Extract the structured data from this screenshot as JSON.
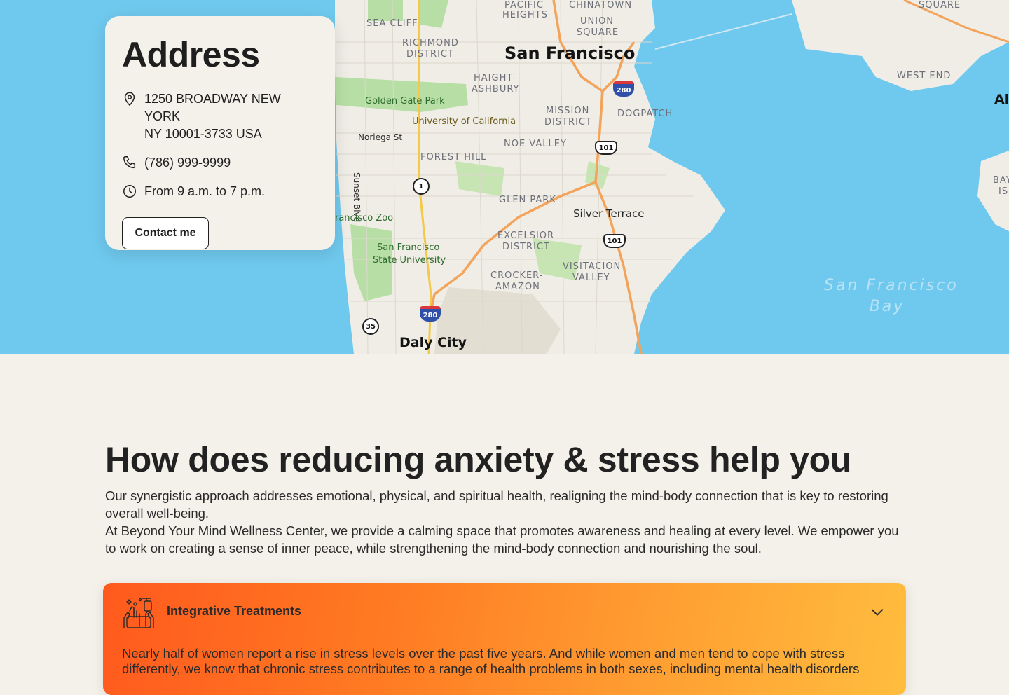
{
  "map": {
    "city_labels": {
      "san_francisco": "San Francisco",
      "daly_city": "Daly City"
    },
    "neighborhoods": {
      "pacific_heights_1": "PACIFIC",
      "pacific_heights_2": "HEIGHTS",
      "chinatown": "CHINATOWN",
      "union_square_1": "UNION",
      "union_square_2": "SQUARE",
      "sea_cliff": "SEA CLIFF",
      "richmond_1": "RICHMOND",
      "richmond_2": "DISTRICT",
      "haight_1": "HAIGHT-",
      "haight_2": "ASHBURY",
      "mission_1": "MISSION",
      "mission_2": "DISTRICT",
      "dogpatch": "DOGPATCH",
      "noe_valley": "NOE VALLEY",
      "forest_hill": "FOREST HILL",
      "glen_park": "GLEN PARK",
      "excelsior_1": "EXCELSIOR",
      "excelsior_2": "DISTRICT",
      "crocker_1": "CROCKER-",
      "crocker_2": "AMAZON",
      "visitacion_1": "VISITACION",
      "visitacion_2": "VALLEY",
      "west_end": "WEST END",
      "square_top": "SQUARE"
    },
    "pois": {
      "golden_gate_park": "Golden Gate Park",
      "uc": "University of California",
      "sf_zoo": "rancisco Zoo",
      "sfsu_1": "San Francisco",
      "sfsu_2": "State University"
    },
    "streets": {
      "noriega": "Noriega St",
      "sunset": "Sunset Blvd"
    },
    "places": {
      "silver_terrace": "Silver Terrace",
      "alameda_partial": "Al",
      "bay_partial_1": "BAY",
      "bay_partial_2": "IS"
    },
    "water": {
      "bay_1": "San Francisco",
      "bay_2": "Bay"
    },
    "shields": {
      "i280_north": "280",
      "i280_south": "280",
      "us101_north": "101",
      "us101_south": "101",
      "ca1": "1",
      "ca35": "35"
    }
  },
  "address_card": {
    "title": "Address",
    "address_line1": "1250  BROADWAY NEW YORK",
    "address_line2": "NY  10001-3733 USA",
    "phone": "(786) 999-9999",
    "hours": "From 9 a.m. to 7 p.m.",
    "contact_button": "Contact me"
  },
  "section": {
    "title": "How does reducing anxiety & stress help you",
    "paragraph1": "Our synergistic approach addresses emotional, physical, and spiritual health, realigning the mind-body connection that is key to restoring overall well-being.",
    "paragraph2": "At Beyond Your Mind Wellness Center, we provide a calming space that promotes awareness and healing at every level. We empower you to work on creating a sense of inner peace, while strengthening the mind-body connection and nourishing the soul."
  },
  "accordion": {
    "title": "Integrative Treatments",
    "icon": "hands-washing-icon",
    "body": "Nearly half of women report a rise in stress levels over the past five years. And while women and men tend to cope with stress differently, we know that chronic stress contributes to a range of health problems in both sexes, including mental health disorders",
    "gradient_start": "#ff5a1e",
    "gradient_end": "#ffbd3e"
  }
}
